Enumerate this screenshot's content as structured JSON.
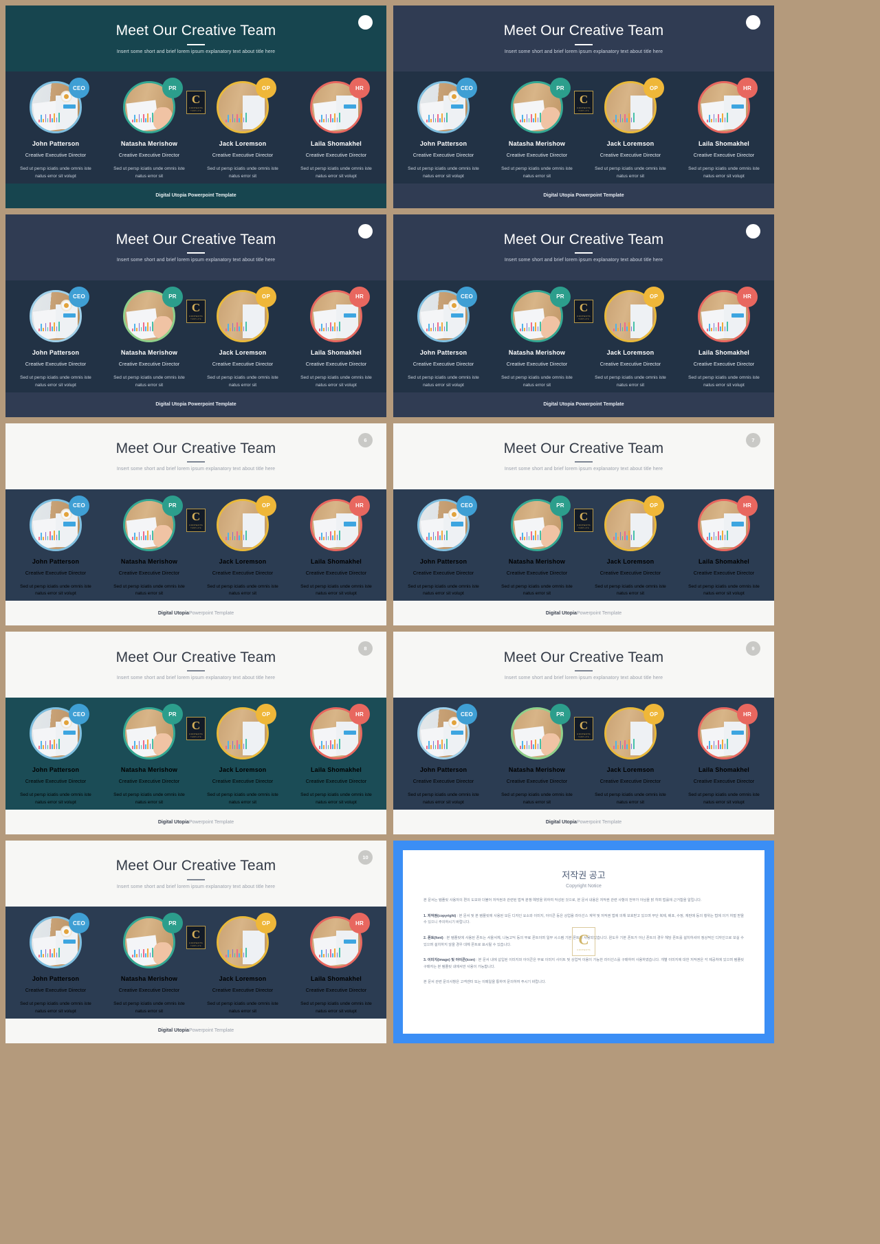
{
  "deck": {
    "title": "Meet Our Creative Team",
    "subtitle": "Insert some short and brief lorem ipsum explanatory text about title here",
    "footer_bold": "Digital Utopia",
    "footer_rest": " Powerpoint Template",
    "footer_full": "Digital Utopia Powerpoint Template"
  },
  "members": [
    {
      "badge": "CEO",
      "name": "John Patterson",
      "role": "Creative Executive Director",
      "desc_line1": "Sed ut persp iciatis unde omnis iste",
      "desc_line2": "natus error sit volupt"
    },
    {
      "badge": "PR",
      "name": "Natasha Merishow",
      "role": "Creative Executive Director",
      "desc_line1": "Sed ut persp iciatis unde omnis iste",
      "desc_line2": "natus error sit"
    },
    {
      "badge": "OP",
      "name": "Jack  Loremson",
      "role": "Creative Executive Director",
      "desc_line1": "Sed ut persp iciatis unde omnis iste",
      "desc_line2": "natus error sit"
    },
    {
      "badge": "HR",
      "name": "Laila Shomakhel",
      "role": "Creative Executive Director",
      "desc_line1": "Sed ut persp iciatis unde omnis iste",
      "desc_line2": "natus error sit volupt"
    }
  ],
  "slides": [
    {
      "n": "",
      "theme": "t-teal",
      "header_dot": ""
    },
    {
      "n": "",
      "theme": "t-navy",
      "header_dot": ""
    },
    {
      "n": "",
      "theme": "t-navy",
      "header_dot": ""
    },
    {
      "n": "",
      "theme": "t-navy",
      "header_dot": ""
    },
    {
      "n": "6",
      "theme": "t-light",
      "header_dot": "6"
    },
    {
      "n": "7",
      "theme": "t-light",
      "header_dot": "7"
    },
    {
      "n": "8",
      "theme": "t-light",
      "header_dot": "8"
    },
    {
      "n": "9",
      "theme": "t-light",
      "header_dot": "9"
    },
    {
      "n": "10",
      "theme": "t-light",
      "header_dot": "10"
    }
  ],
  "logo": {
    "letter": "C",
    "word": "CONTENTS",
    "sub": "TEMPLATE"
  },
  "copyright": {
    "title": "저작권 공고",
    "subtitle": "Copyright Notice",
    "p0": "본 문서는 템플릿 사용자의 편의 도모와 더불어 저작권과 관련된 법적 분쟁 예방을 위하여 작성된 것으로, 본 문서 내용은 저작권  관련 사항의 전부가 아님을 밝 히며 법률에 근거함을 알립니다.",
    "p1_label": "1. 저작권(copyright)",
    "p1": " : 본 문서 및 본 템플릿에 사용된 모든 디자인 요소와 이미지, 아이콘 등은 상업용 라이선스 계약 및 저작권 법에 의해 보호받고 있으며 무단 복제, 배포, 수정, 재판매 등의 행위는 법에 의거 처벌 받을 수 있으니 주의하시기 바랍니다.",
    "p2_label": "2. 폰트(font)",
    "p2": " : 본 템플릿에 사용된 폰트는 서울서체, 나눔고딕 등의 무료 폰트이며 일부 시스템 기본 폰트가 사용되었습니다. 윈도우 기본 폰트가 아닌 폰트의 경우 해당 폰트를 설치하셔야 정상적인 디자인으로 보실 수 있으며 설치하지 않을 경우 대체 폰트로 표시될 수 있습니다.",
    "p3_label": "3. 이미지(image) 및 아이콘(icon)",
    "p3": " : 본 문서 내에 삽입된 이미지와 아이콘은 무료 이미지 사이트 및 상업적 이용이 가능한 라이선스를 구매하여 사용하였습니다. 개별 이미지에 대한 저작권은 각 제공처에 있으며 템플릿 구매자는 본 템플릿 내에서만 사용이 가능합니다.",
    "p4": "본 문서 관련 문의사항은 고객센터 또는 이메일을 통하여 문의하여 주시기 바랍니다."
  }
}
